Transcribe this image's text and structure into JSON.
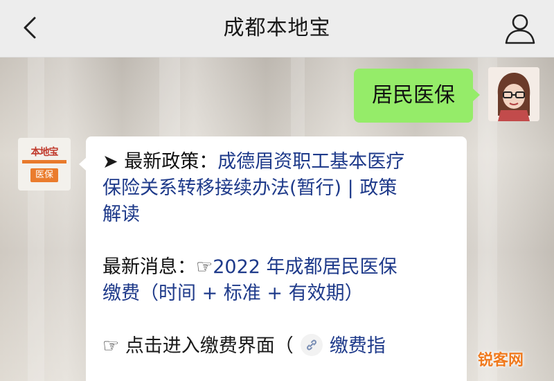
{
  "header": {
    "title": "成都本地宝"
  },
  "chat": {
    "outgoing": {
      "text": "居民医保"
    },
    "bot_avatar": {
      "top_text": "本地宝",
      "tag_text": "医保"
    },
    "incoming": {
      "p1_arrow": "➤",
      "p1_label": "最新政策：",
      "p1_link_a": "成德眉资职工基本医疗",
      "p1_link_b": "保险关系转移接续办法(暂行) | 政策",
      "p1_link_c": "解读",
      "p2_label": "最新消息：",
      "p2_hand": "☞",
      "p2_link_a": "2022 年成都居民医保",
      "p2_link_b": "缴费（时间 + 标准 + 有效期）",
      "p3_hand": "☞",
      "p3_text": "点击进入缴费界面（",
      "p3_link": "缴费指"
    }
  },
  "watermark": "锐客网",
  "colors": {
    "outgoing_bubble": "#95ec69",
    "incoming_bubble": "#ffffff",
    "link": "#1e3a8a",
    "topbar": "#ededed",
    "watermark": "#f07a1e"
  },
  "icons": [
    "back-arrow-icon",
    "person-icon",
    "link-chain-icon"
  ]
}
